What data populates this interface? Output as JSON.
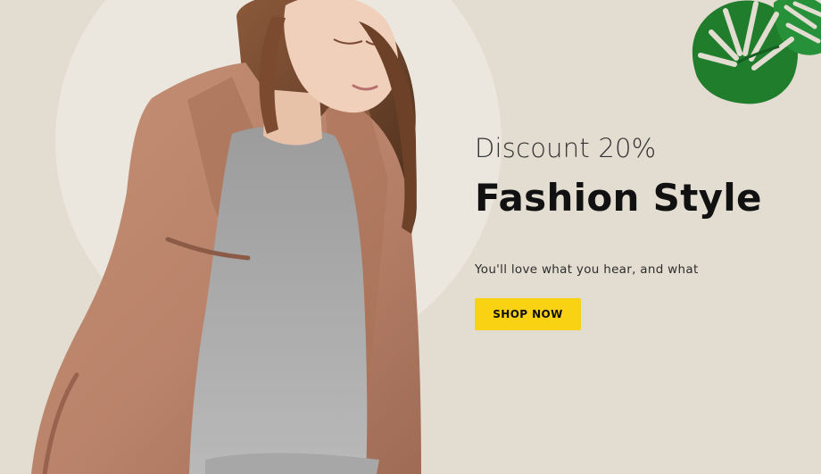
{
  "hero": {
    "eyebrow": "Discount 20%",
    "title": "Fashion Style",
    "tagline": "You'll love what you hear, and what",
    "cta_label": "SHOP NOW"
  },
  "colors": {
    "background": "#e2dcd1",
    "circle": "#ebe7df",
    "button": "#f9d213",
    "title_text": "#111111"
  }
}
